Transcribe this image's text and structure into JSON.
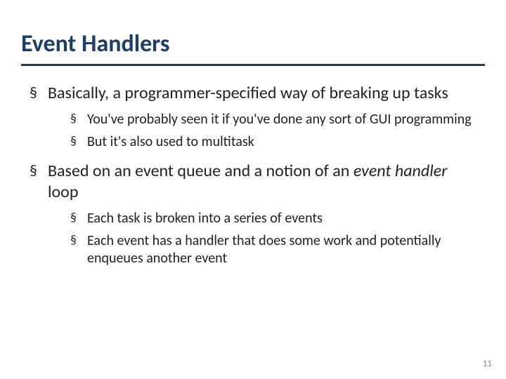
{
  "slide": {
    "title": "Event Handlers",
    "bullets": [
      {
        "text": "Basically, a programmer-specified way of breaking up tasks",
        "sub": [
          {
            "text": "You've probably seen it if you've done any sort of GUI programming"
          },
          {
            "text": "But it's also used to multitask"
          }
        ]
      },
      {
        "prefix": "Based on an event queue and a notion of an ",
        "italic": "event handler",
        "suffix": " loop",
        "sub": [
          {
            "text": "Each task is broken into a series of events"
          },
          {
            "text": "Each event has a handler that does some work and potentially enqueues another event"
          }
        ]
      }
    ],
    "page_number": "11"
  }
}
